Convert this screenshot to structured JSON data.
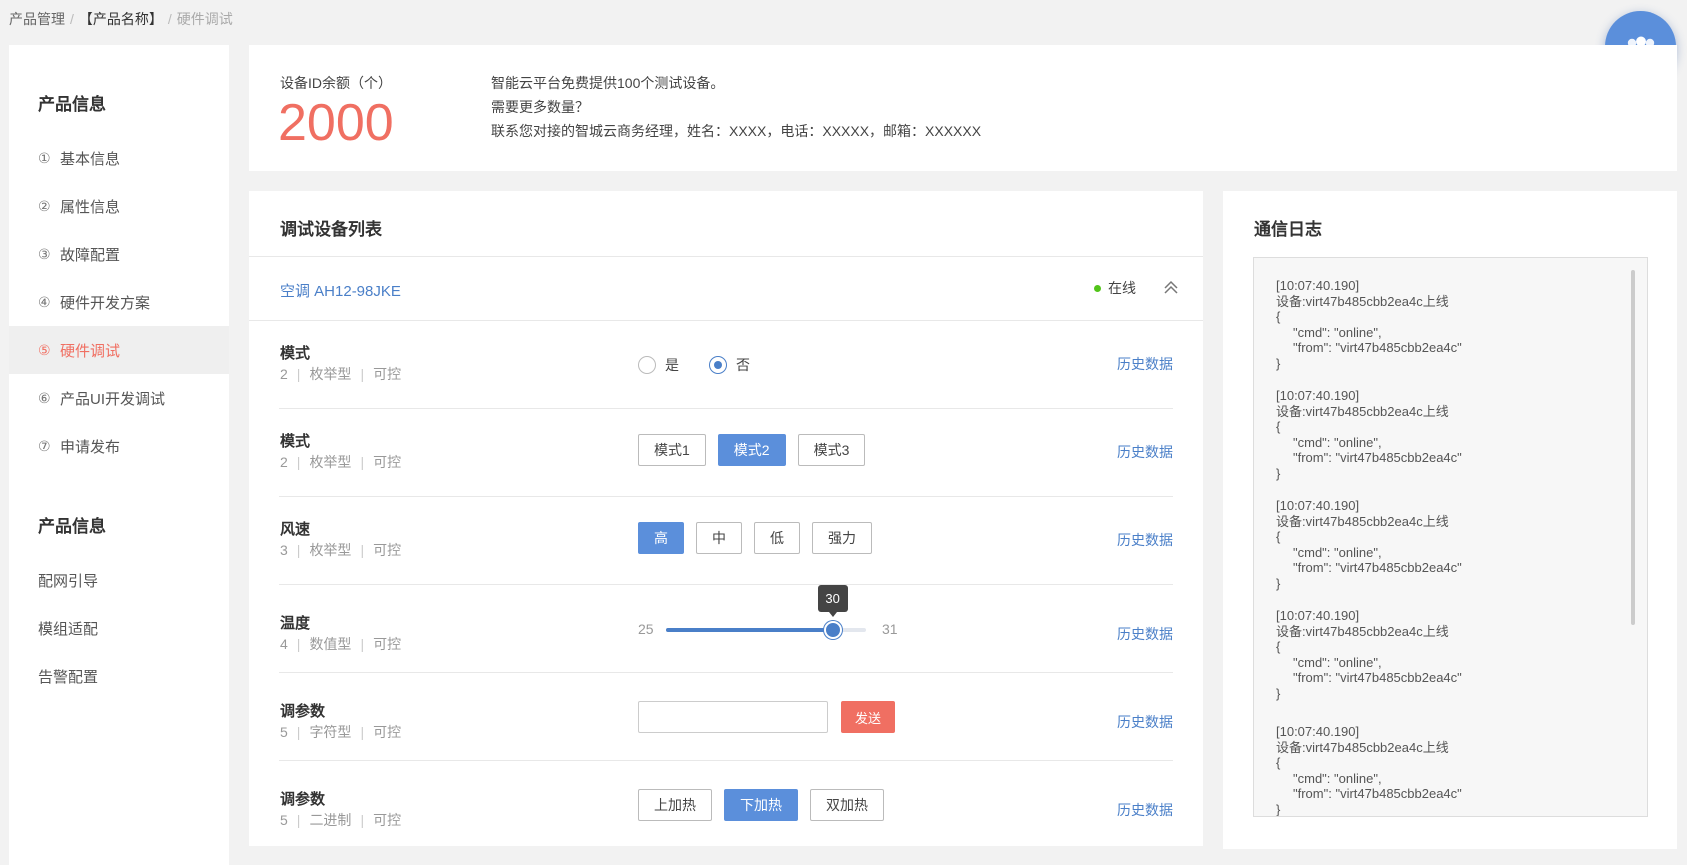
{
  "breadcrumb": {
    "items": [
      "产品管理",
      "【产品名称】",
      "硬件调试"
    ],
    "separator": "/"
  },
  "sidebar": {
    "section1_title": "产品信息",
    "items": [
      {
        "num": "①",
        "label": "基本信息"
      },
      {
        "num": "②",
        "label": "属性信息"
      },
      {
        "num": "③",
        "label": "故障配置"
      },
      {
        "num": "④",
        "label": "硬件开发方案"
      },
      {
        "num": "⑤",
        "label": "硬件调试"
      },
      {
        "num": "⑥",
        "label": "产品UI开发调试"
      },
      {
        "num": "⑦",
        "label": "申请发布"
      }
    ],
    "active_index": 4,
    "section2_title": "产品信息",
    "items2": [
      "配网引导",
      "模组适配",
      "告警配置"
    ]
  },
  "quota": {
    "label": "设备ID余额（个）",
    "value": "2000",
    "notes": [
      "智能云平台免费提供100个测试设备。",
      "需要更多数量？",
      "联系您对接的智城云商务经理，姓名：XXXX，电话：XXXXX，邮箱：XXXXXX"
    ]
  },
  "devices": {
    "title": "调试设备列表",
    "device_name": "空调 AH12-98JKE",
    "status": "在线",
    "history_label": "历史数据",
    "sep": "|",
    "rows": [
      {
        "name": "模式",
        "num": "2",
        "type": "枚举型",
        "ctrl": "可控",
        "options": [
          "是",
          "否"
        ],
        "selected": 1
      },
      {
        "name": "模式",
        "num": "2",
        "type": "枚举型",
        "ctrl": "可控",
        "options": [
          "模式1",
          "模式2",
          "模式3"
        ],
        "selected": 1
      },
      {
        "name": "风速",
        "num": "3",
        "type": "枚举型",
        "ctrl": "可控",
        "options": [
          "高",
          "中",
          "低",
          "强力"
        ],
        "selected": 0
      },
      {
        "name": "温度",
        "num": "4",
        "type": "数值型",
        "ctrl": "可控",
        "min": "25",
        "max": "31",
        "value": "30"
      },
      {
        "name": "调参数",
        "num": "5",
        "type": "字符型",
        "ctrl": "可控",
        "input_value": "",
        "send_label": "发送"
      },
      {
        "name": "调参数",
        "num": "5",
        "type": "二进制",
        "ctrl": "可控",
        "options": [
          "上加热",
          "下加热",
          "双加热"
        ],
        "selected": 1
      }
    ]
  },
  "log": {
    "title": "通信日志",
    "entries": [
      {
        "time": "[10:07:40.190]",
        "msg": "设备:virt47b485cbb2ea4c上线",
        "open": "{",
        "l1": "\"cmd\": \"online\",",
        "l2": "\"from\": \"virt47b485cbb2ea4c\"",
        "close": "}"
      },
      {
        "time": "[10:07:40.190]",
        "msg": "设备:virt47b485cbb2ea4c上线",
        "open": "{",
        "l1": "\"cmd\": \"online\",",
        "l2": "\"from\": \"virt47b485cbb2ea4c\"",
        "close": "}"
      },
      {
        "time": "[10:07:40.190]",
        "msg": "设备:virt47b485cbb2ea4c上线",
        "open": "{",
        "l1": "\"cmd\": \"online\",",
        "l2": "\"from\": \"virt47b485cbb2ea4c\"",
        "close": "}"
      },
      {
        "time": "[10:07:40.190]",
        "msg": "设备:virt47b485cbb2ea4c上线",
        "open": "{",
        "l1": "\"cmd\": \"online\",",
        "l2": "\"from\": \"virt47b485cbb2ea4c\"",
        "close": "}"
      },
      {
        "time": "[10:07:40.190]",
        "msg": "设备:virt47b485cbb2ea4c上线",
        "open": "{",
        "l1": "\"cmd\": \"online\",",
        "l2": "\"from\": \"virt47b485cbb2ea4c\"",
        "close": "}"
      }
    ]
  },
  "colors": {
    "accent": "#5b8fdb",
    "link": "#4a7fc8",
    "danger": "#f06f62",
    "online": "#52c41a"
  }
}
